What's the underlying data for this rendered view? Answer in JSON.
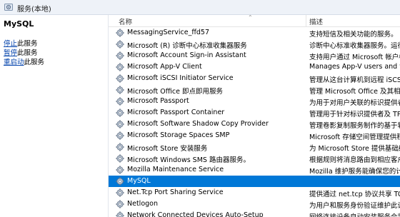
{
  "window": {
    "title": "服务(本地)"
  },
  "left_pane": {
    "service_name": "MySQL",
    "actions": [
      {
        "link": "停止",
        "rest": "此服务"
      },
      {
        "link": "暂停",
        "rest": "此服务"
      },
      {
        "link": "重启动",
        "rest": "此服务"
      }
    ]
  },
  "columns": {
    "name": "名称",
    "desc": "描述"
  },
  "rows": [
    {
      "name": "MessagingService_ffd57",
      "desc": "支持短信及相关功能的服务。"
    },
    {
      "name": "Microsoft (R) 诊断中心标准收集器服务",
      "desc": "诊断中心标准收集器服务。运行"
    },
    {
      "name": "Microsoft Account Sign-in Assistant",
      "desc": "支持用户通过 Microsoft 帐户标"
    },
    {
      "name": "Microsoft App-V Client",
      "desc": "Manages App-V users and vir"
    },
    {
      "name": "Microsoft iSCSI Initiator Service",
      "desc": "管理从这台计算机到远程 iSCSI 目"
    },
    {
      "name": "Microsoft Office 即点即用服务",
      "desc": "管理 Microsoft Office 及其相关"
    },
    {
      "name": "Microsoft Passport",
      "desc": "为用于对用户关联的标识提供者进"
    },
    {
      "name": "Microsoft Passport Container",
      "desc": "管理用于针对标识提供者及 TPM"
    },
    {
      "name": "Microsoft Software Shadow Copy Provider",
      "desc": "管理卷影复制服务制作的基于软件"
    },
    {
      "name": "Microsoft Storage Spaces SMP",
      "desc": "Microsoft 存储空间管理提供程序"
    },
    {
      "name": "Microsoft Store 安装服务",
      "desc": "为 Microsoft Store 提供基础结构"
    },
    {
      "name": "Microsoft Windows SMS 路由器服务。",
      "desc": "根据规则将消息路由到相应客户端"
    },
    {
      "name": "Mozilla Maintenance Service",
      "desc": "Mozilla 维护服务能确保您的计算"
    },
    {
      "name": "MySQL",
      "desc": "",
      "selected": true
    },
    {
      "name": "Net.Tcp Port Sharing Service",
      "desc": "提供通过 net.tcp 协议共享 TCP"
    },
    {
      "name": "Netlogon",
      "desc": "为用户和服务身份验证维护此计算"
    },
    {
      "name": "Network Connected Devices Auto-Setup",
      "desc": "网络连接设备自动安装服务会监视"
    }
  ],
  "colors": {
    "selection": "#0078d7",
    "link": "#0645ad"
  }
}
